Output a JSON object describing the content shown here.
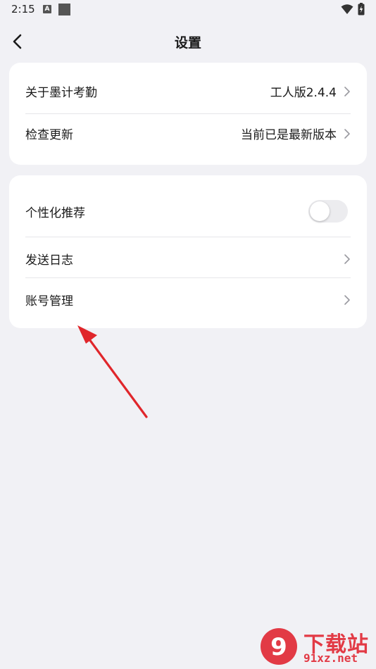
{
  "status_bar": {
    "time": "2:15",
    "notif_letter": "A",
    "icons": [
      "notification-a-icon",
      "notification-square-icon",
      "wifi-icon",
      "battery-charging-icon"
    ]
  },
  "header": {
    "title": "设置",
    "back_icon": "back-arrow-icon"
  },
  "group1": {
    "items": [
      {
        "label": "关于墨计考勤",
        "value": "工人版2.4.4"
      },
      {
        "label": "检查更新",
        "value": "当前已是最新版本"
      }
    ]
  },
  "group2": {
    "items": [
      {
        "label": "个性化推荐",
        "control": "toggle",
        "enabled": false
      },
      {
        "label": "发送日志"
      },
      {
        "label": "账号管理"
      }
    ]
  },
  "annotation": {
    "arrow_color": "#e0262b"
  },
  "watermark": {
    "logo_text": "9",
    "title": "下载站",
    "domain": "91xz.net",
    "color": "#e23a45"
  }
}
